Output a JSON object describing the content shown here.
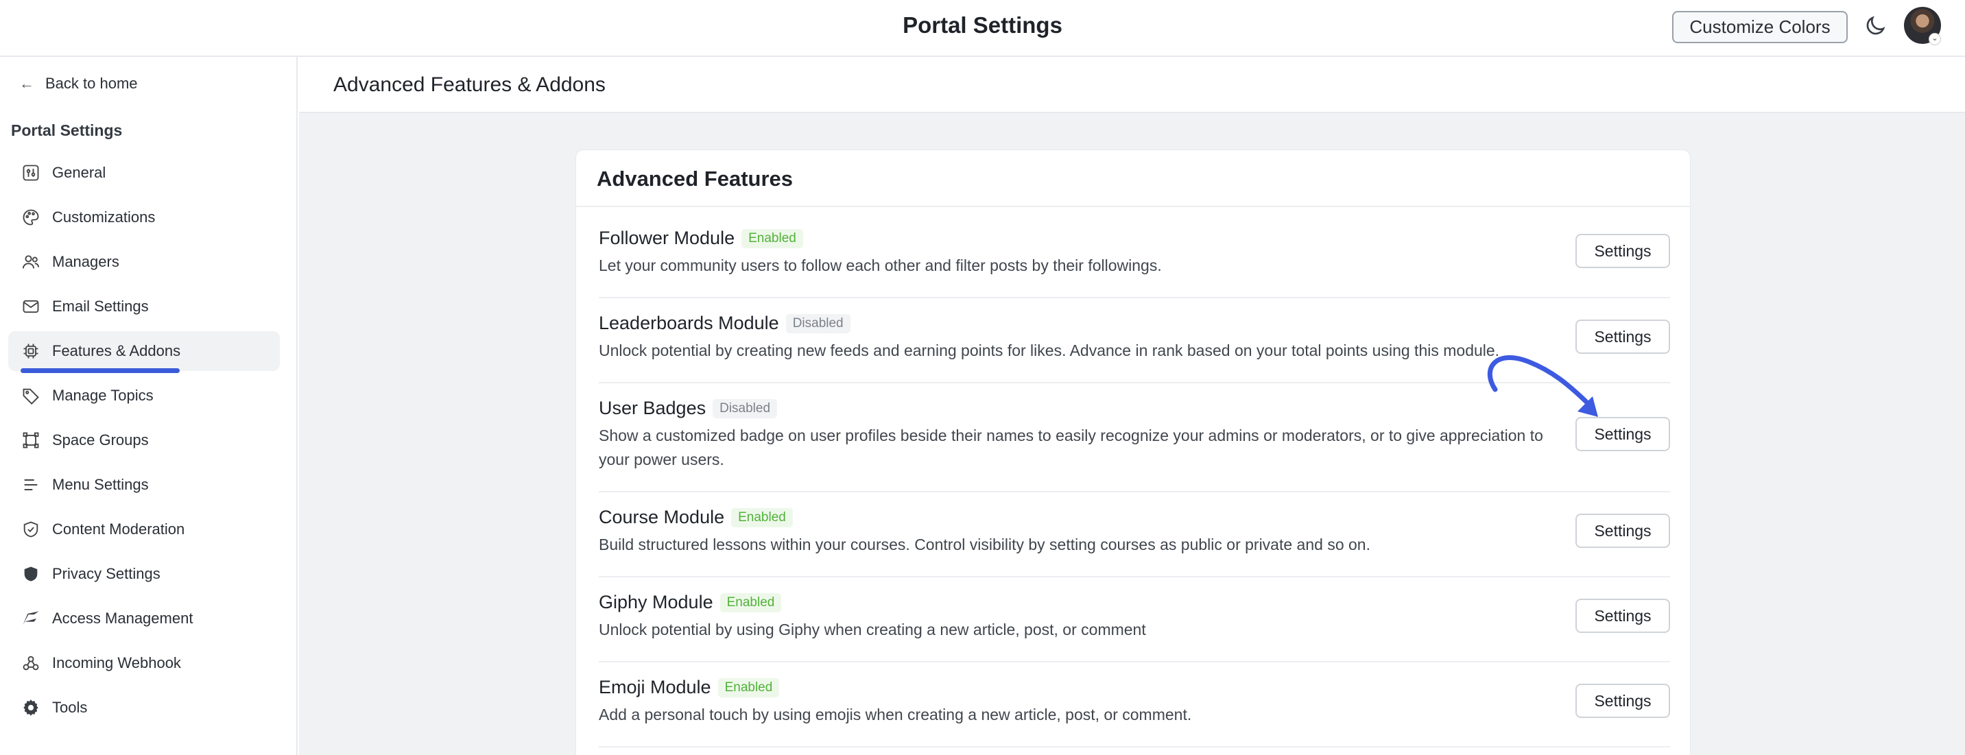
{
  "header": {
    "title": "Portal Settings",
    "customize_label": "Customize Colors"
  },
  "sidebar": {
    "back_label": "Back to home",
    "heading": "Portal Settings",
    "items": [
      {
        "label": "General",
        "icon": "sliders-icon"
      },
      {
        "label": "Customizations",
        "icon": "palette-icon"
      },
      {
        "label": "Managers",
        "icon": "users-icon"
      },
      {
        "label": "Email Settings",
        "icon": "mail-icon"
      },
      {
        "label": "Features & Addons",
        "icon": "chip-icon",
        "active": true
      },
      {
        "label": "Manage Topics",
        "icon": "tag-icon"
      },
      {
        "label": "Space Groups",
        "icon": "group-icon"
      },
      {
        "label": "Menu Settings",
        "icon": "menu-icon"
      },
      {
        "label": "Content Moderation",
        "icon": "shield-check-icon"
      },
      {
        "label": "Privacy Settings",
        "icon": "shield-icon"
      },
      {
        "label": "Access Management",
        "icon": "access-icon"
      },
      {
        "label": "Incoming Webhook",
        "icon": "webhook-icon"
      },
      {
        "label": "Tools",
        "icon": "gear-icon"
      }
    ]
  },
  "main": {
    "page_title": "Advanced Features & Addons",
    "card_title": "Advanced Features",
    "settings_label": "Settings",
    "features": [
      {
        "name": "Follower Module",
        "status": "Enabled",
        "desc": "Let your community users to follow each other and filter posts by their followings."
      },
      {
        "name": "Leaderboards Module",
        "status": "Disabled",
        "desc": "Unlock potential by creating new feeds and earning points for likes. Advance in rank based on your total points using this module."
      },
      {
        "name": "User Badges",
        "status": "Disabled",
        "desc": "Show a customized badge on user profiles beside their names to easily recognize your admins or moderators, or to give appreciation to your power users."
      },
      {
        "name": "Course Module",
        "status": "Enabled",
        "desc": "Build structured lessons within your courses. Control visibility by setting courses as public or private and so on."
      },
      {
        "name": "Giphy Module",
        "status": "Enabled",
        "desc": "Unlock potential by using Giphy when creating a new article, post, or comment"
      },
      {
        "name": "Emoji Module",
        "status": "Enabled",
        "desc": "Add a personal touch by using emojis when creating a new article, post, or comment."
      }
    ]
  },
  "colors": {
    "accent": "#3a5bd9",
    "enabled": "#52b13a",
    "disabled": "#7c818a",
    "annotation_arrow": "#3d5ae0"
  }
}
